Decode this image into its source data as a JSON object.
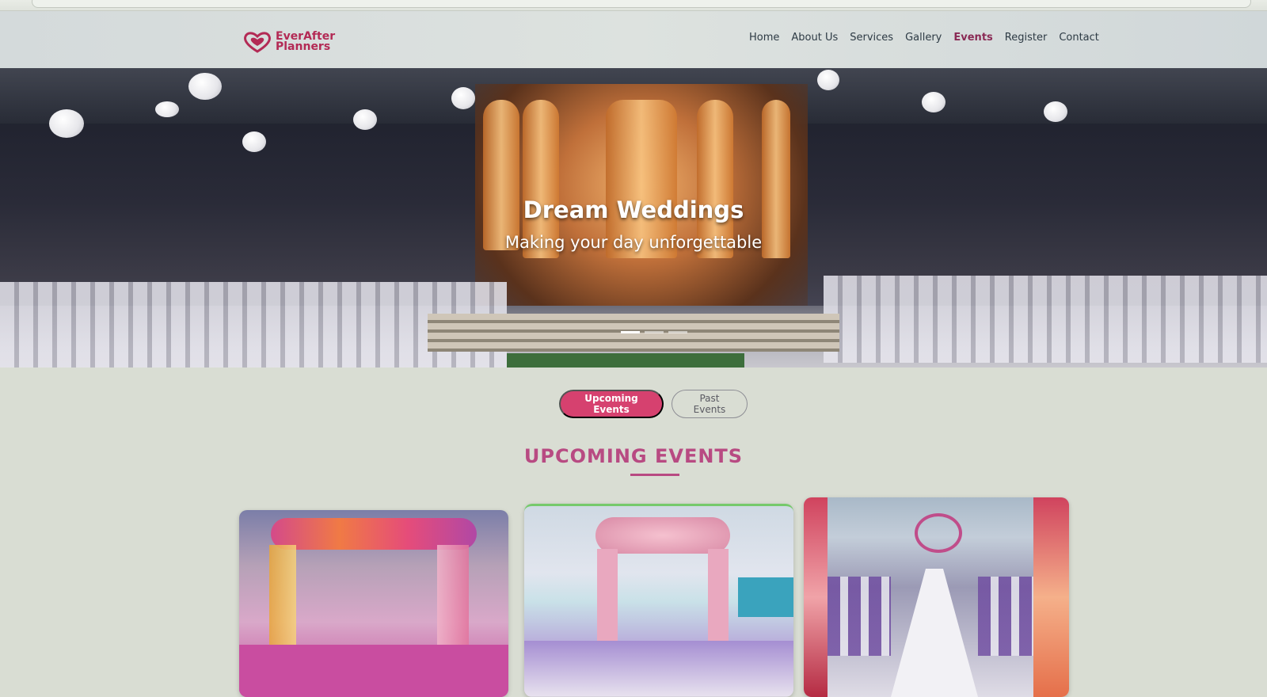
{
  "brand": {
    "name_line1": "EverAfter",
    "name_line2": "Planners",
    "accent": "#b32a55"
  },
  "nav": {
    "items": [
      {
        "label": "Home"
      },
      {
        "label": "About Us"
      },
      {
        "label": "Services"
      },
      {
        "label": "Gallery"
      },
      {
        "label": "Events"
      },
      {
        "label": "Register"
      },
      {
        "label": "Contact"
      }
    ],
    "active": "Events"
  },
  "hero": {
    "title": "Dream Weddings",
    "subtitle": "Making your day unforgettable",
    "slides": 3,
    "active_slide": 1
  },
  "filters": {
    "upcoming_label": "Upcoming Events",
    "past_label": "Past Events",
    "selected": "Upcoming Events"
  },
  "section": {
    "title": "UPCOMING EVENTS"
  },
  "colors": {
    "primary_pink": "#d6416f",
    "heading_magenta": "#b84a82",
    "page_bg": "#d9ddd3"
  }
}
